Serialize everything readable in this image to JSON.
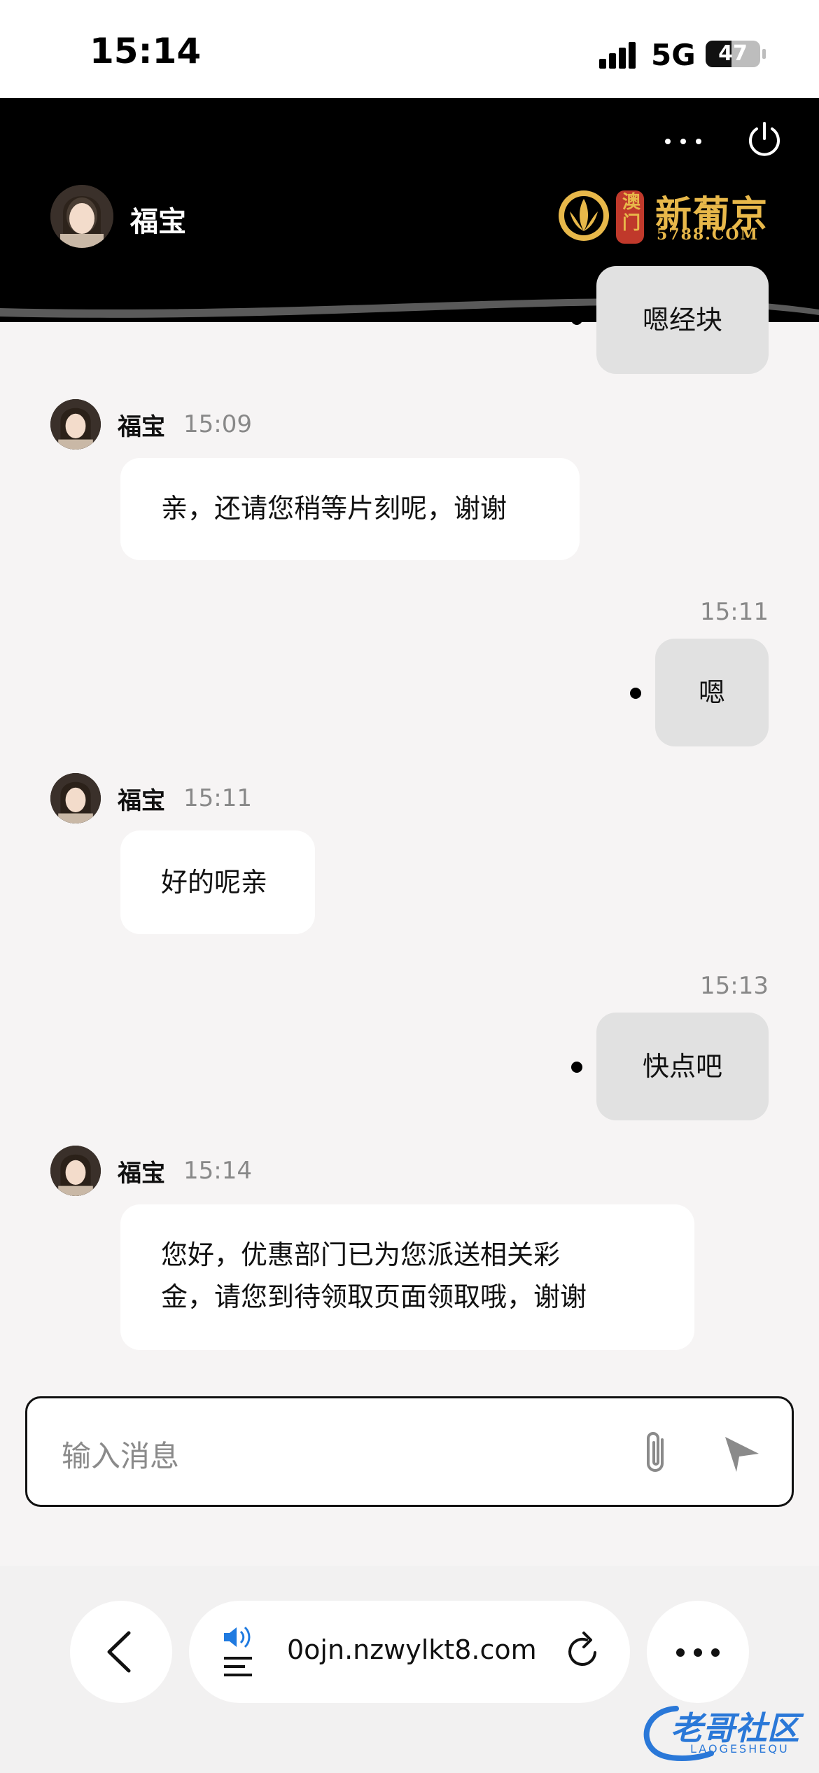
{
  "status_bar": {
    "time": "15:14",
    "network": "5G",
    "battery": "47",
    "battery_level_pct": 47
  },
  "header": {
    "agent_name": "福宝",
    "logo": {
      "badge": "澳门",
      "name": "新葡京",
      "sub": "5788.COM"
    }
  },
  "messages": [
    {
      "side": "right",
      "text": "嗯经块"
    },
    {
      "side": "left",
      "sender": "福宝",
      "time": "15:09",
      "text": "亲，还请您稍等片刻呢，谢谢"
    },
    {
      "side": "right",
      "time": "15:11",
      "text": "嗯"
    },
    {
      "side": "left",
      "sender": "福宝",
      "time": "15:11",
      "text": "好的呢亲"
    },
    {
      "side": "right",
      "time": "15:13",
      "text": "快点吧"
    },
    {
      "side": "left",
      "sender": "福宝",
      "time": "15:14",
      "text_line1": "您好，优惠部门已为您派送相关彩",
      "text_line2": "金，请您到待领取页面领取哦，谢谢"
    }
  ],
  "input": {
    "placeholder": "输入消息"
  },
  "browser": {
    "url": "0ojn.nzwylkt8.com"
  },
  "watermark": {
    "text": "老哥社区",
    "sub": "LAOGESHEQU"
  },
  "colors": {
    "header_bg": "#000000",
    "logo_gold": "#e8b84a",
    "bubble_left": "#ffffff",
    "bubble_right": "#e1e1e1",
    "page_bg": "#f6f4f4"
  },
  "icons": [
    "more-dots-icon",
    "power-icon",
    "attach-icon",
    "send-icon",
    "back-chevron-icon",
    "reader-audio-icon",
    "reload-icon",
    "menu-dots-icon"
  ]
}
